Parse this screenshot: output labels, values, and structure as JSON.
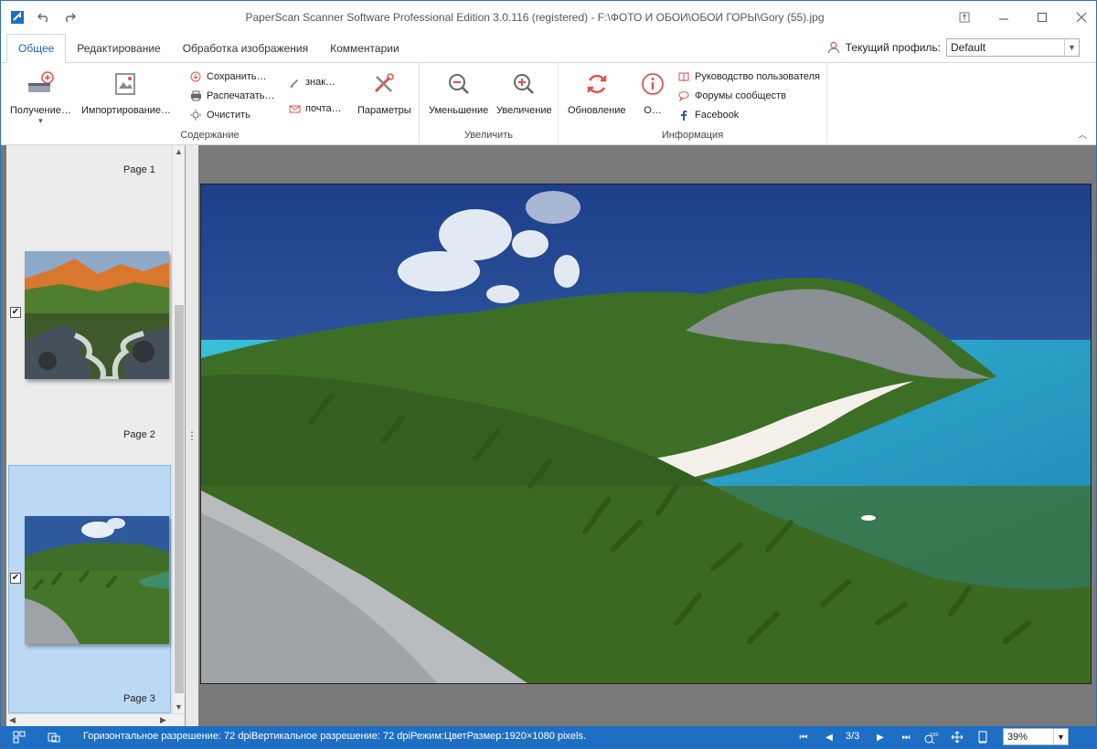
{
  "window": {
    "title": "PaperScan Scanner Software Professional Edition 3.0.116 (registered) - F:\\ФОТО И ОБОИ\\ОБОИ ГОРЫ\\Gory (55).jpg",
    "buttons": [
      "pin-icon",
      "minimize-icon",
      "maximize-icon",
      "close-icon"
    ]
  },
  "tabs": [
    {
      "label": "Общее",
      "active": true
    },
    {
      "label": "Редактирование",
      "active": false
    },
    {
      "label": "Обработка изображения",
      "active": false
    },
    {
      "label": "Комментарии",
      "active": false
    }
  ],
  "profile": {
    "label": "Текущий профиль:",
    "value": "Default"
  },
  "ribbon": {
    "acquire": {
      "label": "Получение…",
      "dropdown": "▾"
    },
    "import": {
      "label": "Импортирование…"
    },
    "save": {
      "label": "Сохранить…"
    },
    "print": {
      "label": "Распечатать…"
    },
    "clear": {
      "label": "Очистить"
    },
    "sign": {
      "label": "знак…"
    },
    "mail": {
      "label": "почта…"
    },
    "settings": {
      "label": "Параметры"
    },
    "zoom_out": {
      "label": "Уменьшение"
    },
    "zoom_in": {
      "label": "Увеличение"
    },
    "update": {
      "label": "Обновление"
    },
    "about": {
      "label": "О…"
    },
    "manual": {
      "label": "Руководство пользователя"
    },
    "forums": {
      "label": "Форумы сообществ"
    },
    "facebook": {
      "label": "Facebook"
    },
    "groups": {
      "content": "Содержание",
      "zoom": "Увеличить",
      "info": "Информация"
    }
  },
  "thumbnails": [
    {
      "label": "Page 1",
      "checked": true,
      "check_mark": "✔"
    },
    {
      "label": "Page 2",
      "checked": true,
      "check_mark": "✔"
    },
    {
      "label": "Page 3",
      "selected": true
    }
  ],
  "status": {
    "text": "Горизонтальное разрешение: 72 dpiВертикальное разрешение: 72 dpiРежим:ЦветРазмер:1920×1080 pixels.",
    "page": "3/3",
    "zoom": "39%"
  },
  "colors": {
    "accent": "#1e6fc4",
    "selection": "#bcd8f5"
  }
}
